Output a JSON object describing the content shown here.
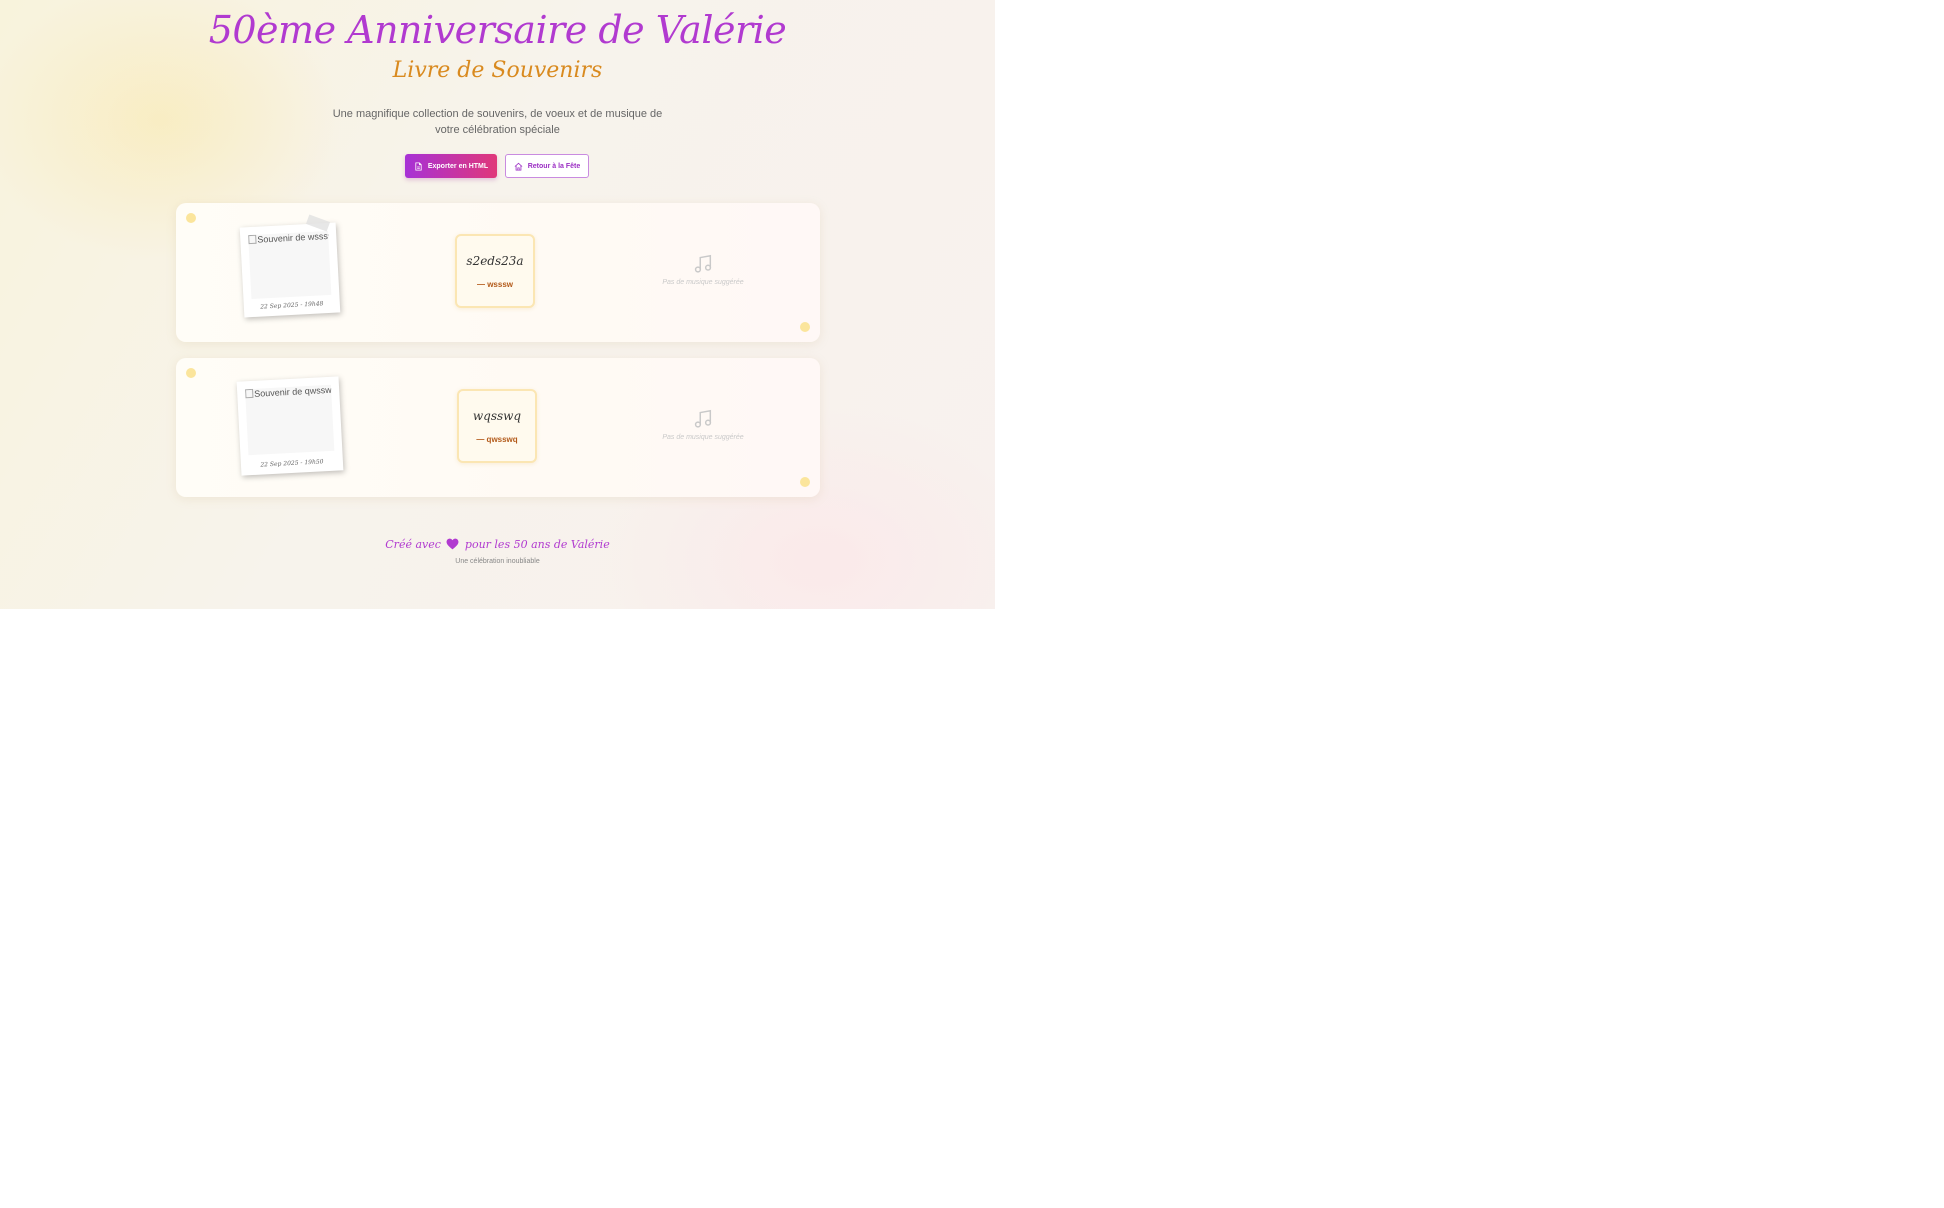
{
  "header": {
    "title": "50ème Anniversaire de Valérie",
    "subtitle": "Livre de Souvenirs",
    "description": "Une magnifique collection de souvenirs, de voeux et de musique de votre célébration spéciale"
  },
  "actions": {
    "export_label": "Exporter en HTML",
    "back_label": "Retour à la Fête"
  },
  "entries": [
    {
      "photo_alt": "Souvenir de wsssw",
      "photo_caption": "22 Sep 2025 - 19h48",
      "message": "s2eds23a",
      "author": "— wsssw",
      "music_label": "Pas de musique suggérée"
    },
    {
      "photo_alt": "Souvenir de qwsswq",
      "photo_caption": "22 Sep 2025 - 19h50",
      "message": "wqsswq",
      "author": "— qwsswq",
      "music_label": "Pas de musique suggérée"
    }
  ],
  "footer": {
    "created_prefix": "Créé avec",
    "created_suffix": "pour les 50 ans de Valérie",
    "tagline": "Une célébration inoubliable"
  },
  "colors": {
    "accent_purple": "#b13ad0",
    "accent_orange": "#d98a1f",
    "dot_yellow": "#fbe59c"
  }
}
